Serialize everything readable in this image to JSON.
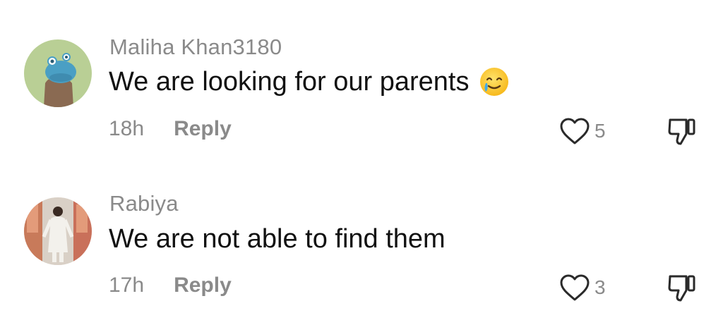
{
  "comments": [
    {
      "username": "Maliha Khan3180",
      "text": "We are looking for our parents",
      "emoji": "face-holding-back-tears-emoji",
      "time": "18h",
      "reply_label": "Reply",
      "likes": "5"
    },
    {
      "username": "Rabiya",
      "text": "We are not able to find them",
      "time": "17h",
      "reply_label": "Reply",
      "likes": "3"
    }
  ],
  "icons": {
    "like": "heart-outline-icon",
    "dislike": "thumbs-down-outline-icon"
  },
  "colors": {
    "muted_text": "#8a8a8a",
    "body_text": "#111111",
    "background": "#ffffff"
  }
}
